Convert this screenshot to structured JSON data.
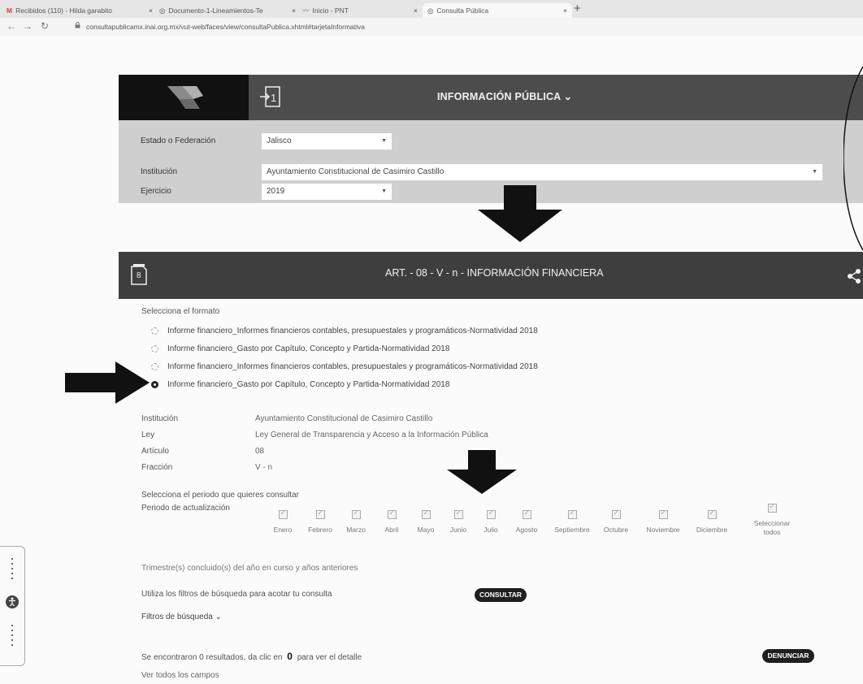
{
  "browser": {
    "tabs": [
      {
        "label": "Recibidos (110) - Hilda garabito",
        "icon": "gmail-icon"
      },
      {
        "label": "Documento-1-Lineamientos-Te",
        "icon": "doc-icon"
      },
      {
        "label": "Inicio - PNT",
        "icon": "pnt-icon"
      },
      {
        "label": "Consulta Pública",
        "icon": "globe-icon",
        "active": true
      }
    ],
    "url": "consultapublicamx.inai.org.mx/vut-web/faces/view/consultaPublica.xhtml#tarjetaInformativa"
  },
  "header": {
    "info_title": "INFORMACIÓN PÚBLICA ⌄"
  },
  "filters": {
    "estado_label": "Estado o Federación",
    "estado_value": "Jalisco",
    "institucion_label": "Institución",
    "institucion_value": "Ayuntamiento Constitucional de Casimiro Castillo",
    "ejercicio_label": "Ejercicio",
    "ejercicio_value": "2019"
  },
  "article": {
    "title": "ART. - 08 - V - n - INFORMACIÓN FINANCIERA",
    "doc_number": "8"
  },
  "format": {
    "prompt": "Selecciona el formato",
    "options": [
      {
        "label": "Informe financiero_Informes financieros contables, presupuestales y programáticos-Normatividad 2018",
        "selected": false
      },
      {
        "label": "Informe financiero_Gasto por Capítulo, Concepto y Partida-Normatividad 2018",
        "selected": false
      },
      {
        "label": "Informe financiero_Informes financieros contables, presupuestales y programáticos-Normatividad 2018",
        "selected": false
      },
      {
        "label": "Informe financiero_Gasto por Capítulo, Concepto y Partida-Normatividad 2018",
        "selected": true
      }
    ]
  },
  "details": {
    "institucion_label": "Institución",
    "institucion_value": "Ayuntamiento Constitucional de Casimiro Castillo",
    "ley_label": "Ley",
    "ley_value": "Ley General de Transparencia y Acceso a la Información Pública",
    "articulo_label": "Artículo",
    "articulo_value": "08",
    "fraccion_label": "Fracción",
    "fraccion_value": "V - n"
  },
  "period": {
    "prompt": "Selecciona el periodo que quieres consultar",
    "label": "Periodo de actualización",
    "months": [
      "Enero",
      "Febrero",
      "Marzo",
      "Abril",
      "Mayo",
      "Junio",
      "Julio",
      "Agosto",
      "Septiembre",
      "Octubre",
      "Noviembre",
      "Diciembre"
    ],
    "select_all": "Seleccionar todos"
  },
  "notes": {
    "trimestres": "Trimestre(s) concluido(s) del año en curso y años anteriores",
    "filters_hint": "Utiliza los filtros de búsqueda para acotar tu consulta",
    "consultar": "CONSULTAR",
    "filtros": "Filtros de búsqueda ⌄",
    "results_prefix": "Se encontraron 0 resultados, da clic en",
    "results_count": "0",
    "results_suffix": "para ver el detalle",
    "denunciar": "DENUNCIAR",
    "ver_todos": "Ver todos los campos"
  }
}
